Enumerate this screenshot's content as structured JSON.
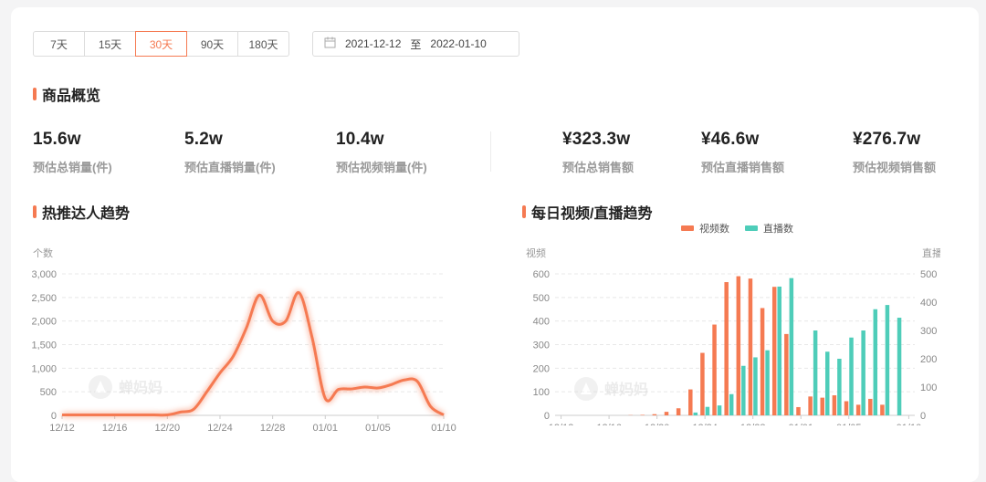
{
  "filters": {
    "tabs": [
      {
        "label": "7天",
        "active": false
      },
      {
        "label": "15天",
        "active": false
      },
      {
        "label": "30天",
        "active": true
      },
      {
        "label": "90天",
        "active": false
      },
      {
        "label": "180天",
        "active": false
      }
    ],
    "date_start": "2021-12-12",
    "date_separator": "至",
    "date_end": "2022-01-10"
  },
  "overview": {
    "title": "商品概览",
    "metrics": [
      {
        "value": "15.6w",
        "label": "预估总销量(件)"
      },
      {
        "value": "5.2w",
        "label": "预估直播销量(件)"
      },
      {
        "value": "10.4w",
        "label": "预估视频销量(件)"
      },
      {
        "value": "¥323.3w",
        "label": "预估总销售额"
      },
      {
        "value": "¥46.6w",
        "label": "预估直播销售额"
      },
      {
        "value": "¥276.7w",
        "label": "预估视频销售额"
      }
    ]
  },
  "watermark": "蝉妈妈",
  "colors": {
    "accent": "#f57a52",
    "teal": "#4ecdb9",
    "grid": "#e6e6e6"
  },
  "chart_data": [
    {
      "type": "line",
      "title": "热推达人趋势",
      "ylabel": "个数",
      "ylim": [
        0,
        3000
      ],
      "yticks": [
        "0",
        "500",
        "1,000",
        "1,500",
        "2,000",
        "2,500",
        "3,000"
      ],
      "xticks": [
        "12/12",
        "12/16",
        "12/20",
        "12/24",
        "12/28",
        "01/01",
        "01/05",
        "01/10"
      ],
      "x": [
        "12/12",
        "12/13",
        "12/14",
        "12/15",
        "12/16",
        "12/17",
        "12/18",
        "12/19",
        "12/20",
        "12/21",
        "12/22",
        "12/23",
        "12/24",
        "12/25",
        "12/26",
        "12/27",
        "12/28",
        "12/29",
        "12/30",
        "12/31",
        "01/01",
        "01/02",
        "01/03",
        "01/04",
        "01/05",
        "01/06",
        "01/07",
        "01/08",
        "01/09",
        "01/10"
      ],
      "series": [
        {
          "values": [
            10,
            10,
            10,
            10,
            10,
            10,
            10,
            10,
            10,
            70,
            130,
            500,
            900,
            1250,
            1850,
            2550,
            2000,
            2000,
            2600,
            1650,
            360,
            550,
            560,
            600,
            580,
            650,
            750,
            720,
            190,
            10
          ]
        }
      ],
      "color": "#f57a52"
    },
    {
      "type": "bar",
      "title": "每日视频/直播趋势",
      "ylabel": "视频",
      "y2label": "直播",
      "ylim": [
        0,
        600
      ],
      "y2lim": [
        0,
        500
      ],
      "yticks": [
        "0",
        "100",
        "200",
        "300",
        "400",
        "500",
        "600"
      ],
      "y2ticks": [
        "0",
        "100",
        "200",
        "300",
        "400",
        "500"
      ],
      "xticks": [
        "12/12",
        "12/16",
        "12/20",
        "12/24",
        "12/28",
        "01/01",
        "01/05",
        "01/10"
      ],
      "x": [
        "12/12",
        "12/13",
        "12/14",
        "12/15",
        "12/16",
        "12/17",
        "12/18",
        "12/19",
        "12/20",
        "12/21",
        "12/22",
        "12/23",
        "12/24",
        "12/25",
        "12/26",
        "12/27",
        "12/28",
        "12/29",
        "12/30",
        "12/31",
        "01/01",
        "01/02",
        "01/03",
        "01/04",
        "01/05",
        "01/06",
        "01/07",
        "01/08",
        "01/09",
        "01/10"
      ],
      "series": [
        {
          "name": "视频数",
          "axis": "left",
          "color": "#f57a52",
          "values": [
            0,
            0,
            0,
            0,
            0,
            0,
            1,
            2,
            5,
            15,
            30,
            110,
            265,
            385,
            565,
            590,
            580,
            455,
            545,
            345,
            35,
            80,
            75,
            85,
            60,
            45,
            70,
            45,
            0,
            0
          ]
        },
        {
          "name": "直播数",
          "axis": "right",
          "color": "#4ecdb9",
          "values": [
            0,
            0,
            0,
            0,
            0,
            0,
            0,
            0,
            0,
            0,
            0,
            10,
            30,
            35,
            75,
            175,
            205,
            230,
            455,
            485,
            0,
            300,
            225,
            200,
            275,
            300,
            375,
            390,
            345,
            0
          ]
        }
      ]
    }
  ]
}
